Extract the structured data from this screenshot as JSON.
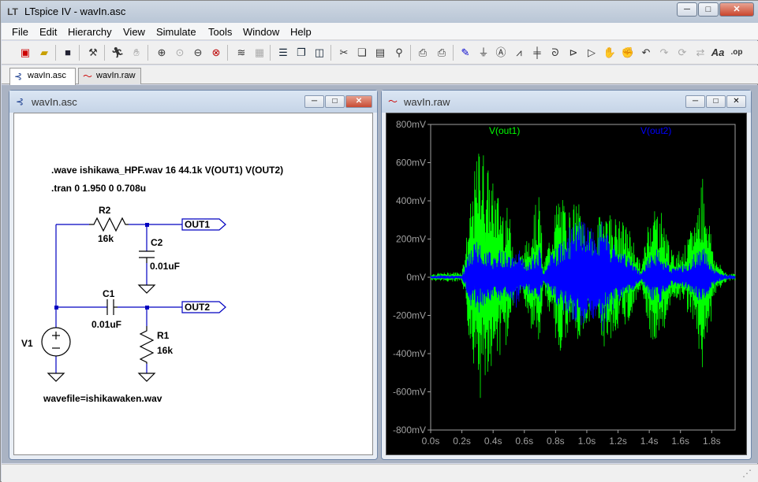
{
  "window": {
    "title": "LTspice IV - wavIn.asc",
    "app_icon": "ltspice-logo-icon"
  },
  "window_buttons": {
    "minimize": "─",
    "maximize": "□",
    "close": "✕"
  },
  "menu": [
    "File",
    "Edit",
    "Hierarchy",
    "View",
    "Simulate",
    "Tools",
    "Window",
    "Help"
  ],
  "toolbar_icons": [
    "new-schematic-icon",
    "open-icon",
    "save-icon",
    "control-panel-icon",
    "run-icon",
    "halt-icon",
    "zoom-in-icon",
    "pan-icon",
    "zoom-out-icon",
    "zoom-fit-icon",
    "autorange-icon",
    "grid-icon",
    "tile-horizontal-icon",
    "cascade-icon",
    "tile-vertical-icon",
    "cut-icon",
    "copy-icon",
    "paste-icon",
    "find-icon",
    "print-setup-icon",
    "print-icon",
    "draw-wire-icon",
    "ground-icon",
    "label-net-icon",
    "resistor-icon",
    "capacitor-icon",
    "inductor-icon",
    "diode-icon",
    "component-icon",
    "move-icon",
    "drag-icon",
    "undo-icon",
    "redo-icon",
    "rotate-icon",
    "mirror-icon",
    "text-icon",
    "spice-directive-icon"
  ],
  "toolbar_text": {
    "text": "Aa",
    "spice": ".op"
  },
  "tabs": [
    {
      "label": "wavIn.asc",
      "icon": "schematic-icon",
      "active": true
    },
    {
      "label": "wavIn.raw",
      "icon": "waveform-icon",
      "active": false
    }
  ],
  "schematic_window": {
    "title": "wavIn.asc",
    "directives": [
      ".wave ishikawa_HPF.wav 16 44.1k V(OUT1) V(OUT2)",
      ".tran 0 1.950 0 0.708u"
    ],
    "components": {
      "r2": {
        "name": "R2",
        "value": "16k"
      },
      "c2": {
        "name": "C2",
        "value": "0.01uF"
      },
      "c1": {
        "name": "C1",
        "value": "0.01uF"
      },
      "r1": {
        "name": "R1",
        "value": "16k"
      },
      "v1": {
        "name": "V1",
        "value": "wavefile=ishikawaken.wav"
      }
    },
    "net_labels": [
      "OUT1",
      "OUT2"
    ]
  },
  "waveform_window": {
    "title": "wavIn.raw",
    "colors": {
      "background": "#000000",
      "axis": "#a0a0a0",
      "out1": "#00ff00",
      "out2": "#0000ff"
    }
  },
  "chart_data": {
    "type": "line",
    "xlabel": "",
    "ylabel": "",
    "xlim": [
      0,
      1.95
    ],
    "ylim": [
      -0.8,
      0.8
    ],
    "x_ticks": [
      "0.0s",
      "0.2s",
      "0.4s",
      "0.6s",
      "0.8s",
      "1.0s",
      "1.2s",
      "1.4s",
      "1.6s",
      "1.8s"
    ],
    "x_tick_values": [
      0,
      0.2,
      0.4,
      0.6,
      0.8,
      1.0,
      1.2,
      1.4,
      1.6,
      1.8
    ],
    "y_ticks": [
      "800mV",
      "600mV",
      "400mV",
      "200mV",
      "0mV",
      "-200mV",
      "-400mV",
      "-600mV",
      "-800mV"
    ],
    "y_tick_values": [
      0.8,
      0.6,
      0.4,
      0.2,
      0,
      -0.2,
      -0.4,
      -0.6,
      -0.8
    ],
    "grid": false,
    "legend": "top",
    "series": [
      {
        "name": "V(out1)",
        "color": "#00ff00",
        "envelope": [
          [
            0,
            0.02
          ],
          [
            0.2,
            0.03
          ],
          [
            0.25,
            0.35
          ],
          [
            0.28,
            0.55
          ],
          [
            0.32,
            0.75
          ],
          [
            0.36,
            0.6
          ],
          [
            0.4,
            0.5
          ],
          [
            0.45,
            0.42
          ],
          [
            0.5,
            0.35
          ],
          [
            0.55,
            0.1
          ],
          [
            0.6,
            0.15
          ],
          [
            0.66,
            0.35
          ],
          [
            0.7,
            0.45
          ],
          [
            0.72,
            0.05
          ],
          [
            0.78,
            0.3
          ],
          [
            0.82,
            0.45
          ],
          [
            0.88,
            0.35
          ],
          [
            0.9,
            0.38
          ],
          [
            0.95,
            0.4
          ],
          [
            1.0,
            0.28
          ],
          [
            1.05,
            0.2
          ],
          [
            1.1,
            0.4
          ],
          [
            1.15,
            0.35
          ],
          [
            1.2,
            0.3
          ],
          [
            1.22,
            0.3
          ],
          [
            1.28,
            0.25
          ],
          [
            1.35,
            0.05
          ],
          [
            1.4,
            0.35
          ],
          [
            1.42,
            0.4
          ],
          [
            1.48,
            0.35
          ],
          [
            1.55,
            0.12
          ],
          [
            1.6,
            0.15
          ],
          [
            1.64,
            0.18
          ],
          [
            1.7,
            0.35
          ],
          [
            1.74,
            0.55
          ],
          [
            1.77,
            0.4
          ],
          [
            1.82,
            0.1
          ],
          [
            1.9,
            0.02
          ],
          [
            1.95,
            0.02
          ]
        ]
      },
      {
        "name": "V(out2)",
        "color": "#0000ff",
        "envelope": [
          [
            0,
            0.01
          ],
          [
            0.2,
            0.01
          ],
          [
            0.25,
            0.15
          ],
          [
            0.3,
            0.2
          ],
          [
            0.35,
            0.16
          ],
          [
            0.4,
            0.12
          ],
          [
            0.45,
            0.15
          ],
          [
            0.5,
            0.12
          ],
          [
            0.55,
            0.18
          ],
          [
            0.6,
            0.08
          ],
          [
            0.65,
            0.12
          ],
          [
            0.7,
            0.16
          ],
          [
            0.72,
            0.02
          ],
          [
            0.78,
            0.14
          ],
          [
            0.85,
            0.2
          ],
          [
            0.9,
            0.28
          ],
          [
            1.0,
            0.3
          ],
          [
            1.05,
            0.25
          ],
          [
            1.1,
            0.3
          ],
          [
            1.15,
            0.2
          ],
          [
            1.2,
            0.15
          ],
          [
            1.25,
            0.12
          ],
          [
            1.3,
            0.08
          ],
          [
            1.35,
            0.02
          ],
          [
            1.4,
            0.12
          ],
          [
            1.45,
            0.16
          ],
          [
            1.5,
            0.1
          ],
          [
            1.55,
            0.05
          ],
          [
            1.6,
            0.06
          ],
          [
            1.65,
            0.08
          ],
          [
            1.7,
            0.14
          ],
          [
            1.75,
            0.16
          ],
          [
            1.8,
            0.06
          ],
          [
            1.85,
            0.02
          ],
          [
            1.95,
            0.01
          ]
        ]
      }
    ]
  }
}
